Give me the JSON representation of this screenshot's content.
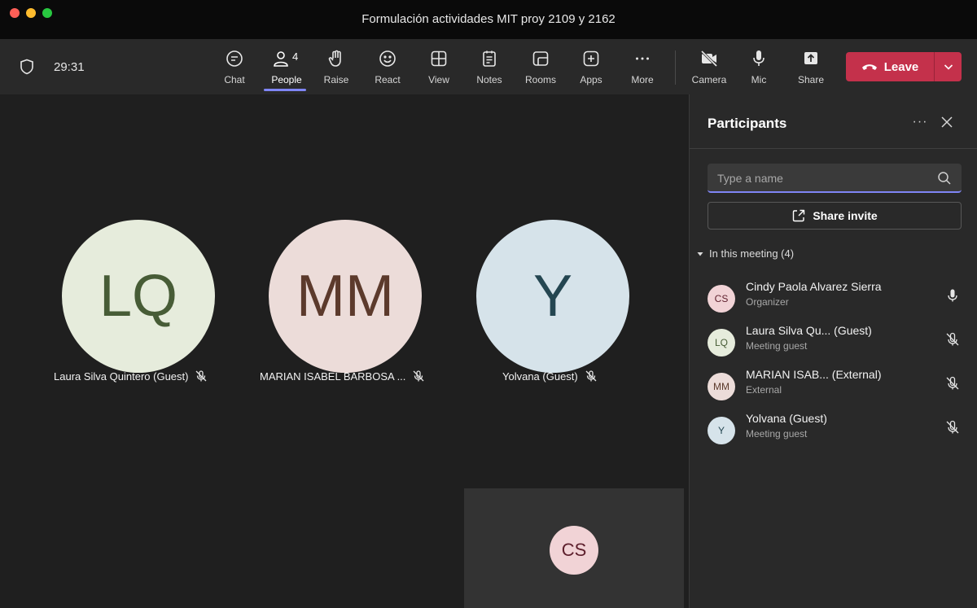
{
  "window": {
    "title": "Formulación actividades MIT proy 2109 y 2162"
  },
  "toolbar": {
    "timer": "29:31",
    "buttons": {
      "chat": "Chat",
      "people": "People",
      "people_count": "4",
      "raise": "Raise",
      "react": "React",
      "view": "View",
      "notes": "Notes",
      "rooms": "Rooms",
      "apps": "Apps",
      "more": "More",
      "camera": "Camera",
      "mic": "Mic",
      "share": "Share"
    },
    "leave_label": "Leave",
    "accent": "#7f85f5",
    "leave_color": "#c4314b"
  },
  "stage": {
    "tiles": [
      {
        "initials": "LQ",
        "name": "Laura Silva Quintero (Guest)",
        "muted": true,
        "bg": "#e6ecdc",
        "fg": "#475c36"
      },
      {
        "initials": "MM",
        "name": "MARIAN ISABEL BARBOSA ...",
        "muted": true,
        "bg": "#ecdcd9",
        "fg": "#5c3a2c"
      },
      {
        "initials": "Y",
        "name": "Yolvana (Guest)",
        "muted": true,
        "bg": "#d6e3ea",
        "fg": "#244651"
      }
    ],
    "self": {
      "initials": "CS"
    }
  },
  "panel": {
    "title": "Participants",
    "more_label": "···",
    "search_placeholder": "Type a name",
    "share_invite": "Share invite",
    "section_label": "In this meeting (4)",
    "participants": [
      {
        "initials": "CS",
        "name": "Cindy Paola Alvarez Sierra",
        "role": "Organizer",
        "muted": false,
        "bg": "#f1d3d6",
        "fg": "#5d1f2c"
      },
      {
        "initials": "LQ",
        "name": "Laura Silva Qu... (Guest)",
        "role": "Meeting guest",
        "muted": true,
        "bg": "#e6ecdc",
        "fg": "#475c36"
      },
      {
        "initials": "MM",
        "name": "MARIAN ISAB... (External)",
        "role": "External",
        "muted": true,
        "bg": "#ecdcd9",
        "fg": "#5c3a2c"
      },
      {
        "initials": "Y",
        "name": "Yolvana (Guest)",
        "role": "Meeting guest",
        "muted": true,
        "bg": "#d6e3ea",
        "fg": "#244651"
      }
    ]
  }
}
